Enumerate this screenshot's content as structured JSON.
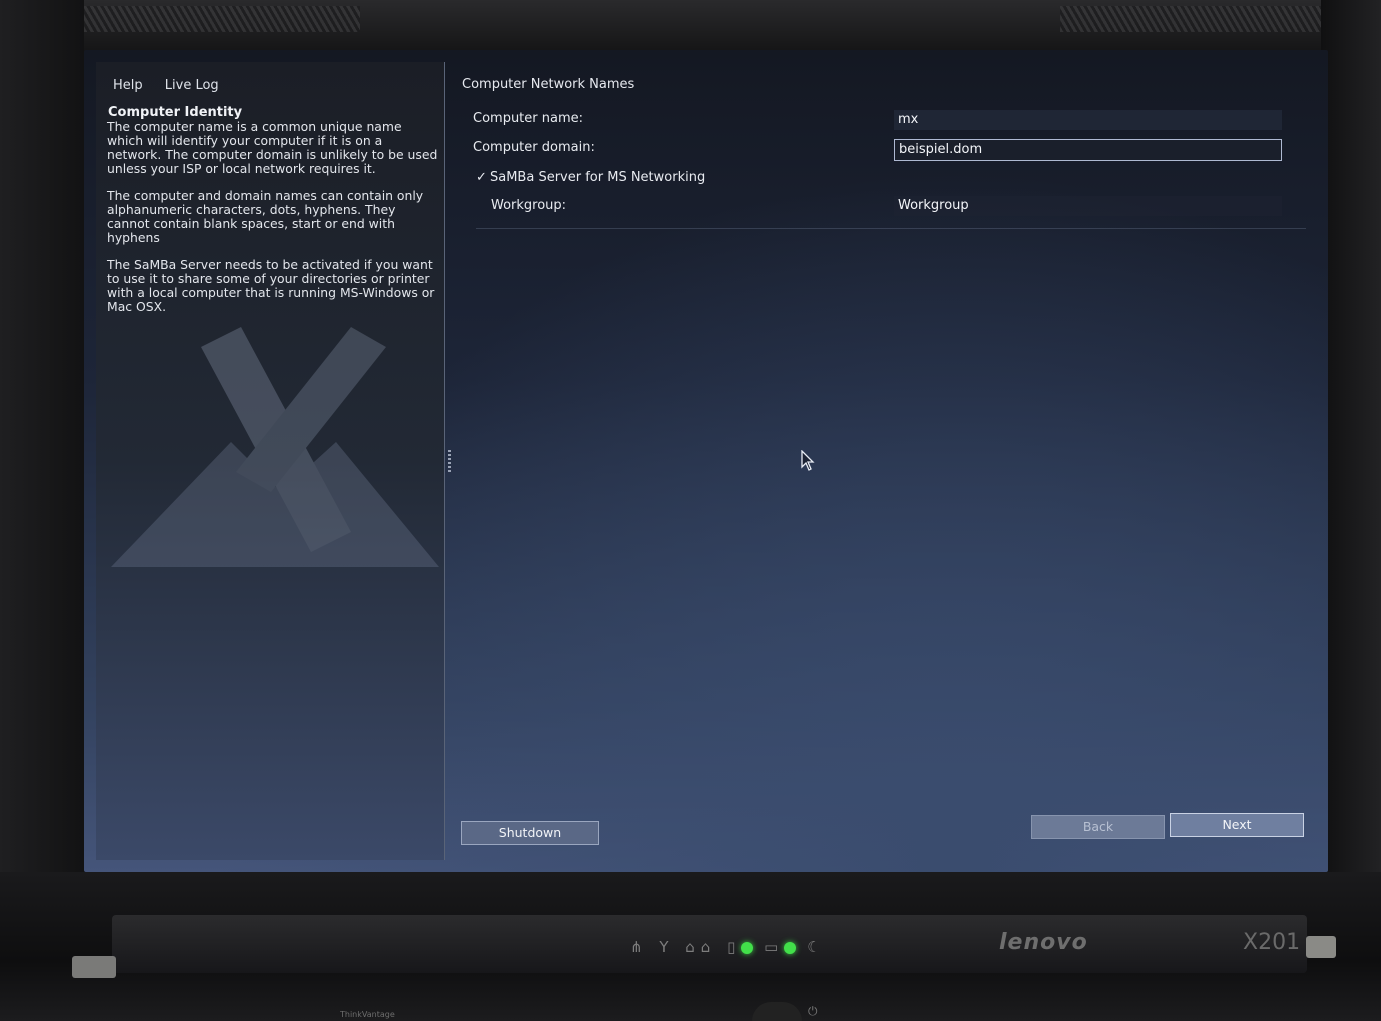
{
  "menu": {
    "help": "Help",
    "live_log": "Live Log"
  },
  "help": {
    "title": "Computer Identity",
    "paragraphs": [
      "The computer name is a common unique name which will identify your computer if it is on a network. The computer domain is unlikely to be used unless your ISP or local network requires it.",
      "The computer and domain names can contain only alphanumeric characters, dots, hyphens. They cannot contain blank spaces, start or end with hyphens",
      "The SaMBa Server needs to be activated if you want to use it to share some of your directories or printer with a local computer that is running MS-Windows or Mac OSX."
    ]
  },
  "form": {
    "section_title": "Computer Network Names",
    "computer_name_label": "Computer name:",
    "computer_name_value": "mx",
    "computer_domain_label": "Computer domain:",
    "computer_domain_value": "beispiel.dom",
    "samba_check_mark": "✓",
    "samba_label": "SaMBa Server for MS Networking",
    "samba_checked": true,
    "workgroup_label": "Workgroup:",
    "workgroup_value": "Workgroup"
  },
  "buttons": {
    "shutdown": "Shutdown",
    "back": "Back",
    "next": "Next"
  },
  "laptop": {
    "brand": "lenovo",
    "model": "X201",
    "sublabel": "ThinkVantage"
  },
  "colors": {
    "led_green": "#42e04a",
    "screen_top": "#141822",
    "screen_bottom": "#45557a"
  },
  "icons": [
    "x-watermark-icon",
    "mouse-cursor-icon",
    "check-icon",
    "power-icon",
    "wifi-icon",
    "battery-icon"
  ]
}
